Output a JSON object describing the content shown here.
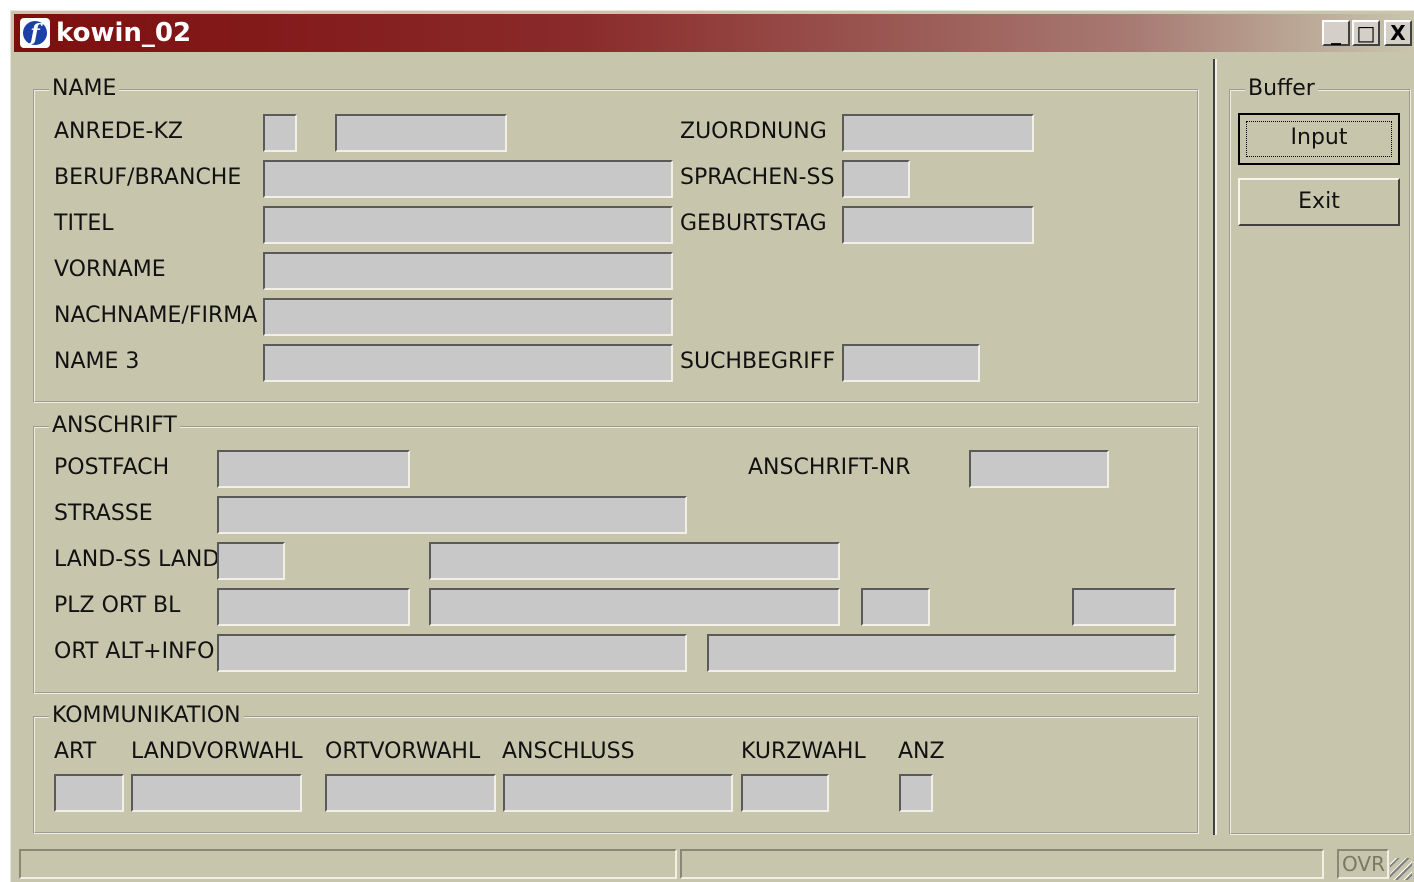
{
  "window": {
    "title": "kowin_02",
    "controls": {
      "minimize": "_",
      "maximize": "□",
      "close": "X"
    }
  },
  "name_group": {
    "legend": "NAME",
    "anrede_label": "ANREDE-KZ",
    "zuordnung_label": "ZUORDNUNG",
    "beruf_label": "BERUF/BRANCHE",
    "sprachen_label": "SPRACHEN-SS",
    "titel_label": "TITEL",
    "geburtstag_label": "GEBURTSTAG",
    "vorname_label": "VORNAME",
    "nachname_label": "NACHNAME/FIRMA",
    "name3_label": "NAME 3",
    "suchbegriff_label": "SUCHBEGRIFF"
  },
  "anschrift_group": {
    "legend": "ANSCHRIFT",
    "postfach_label": "POSTFACH",
    "anschrift_nr_label": "ANSCHRIFT-NR",
    "strasse_label": "STRASSE",
    "land_label": "LAND-SS LAND",
    "plz_label": "PLZ ORT BL",
    "ort_alt_label": "ORT ALT+INFO"
  },
  "kommunikation_group": {
    "legend": "KOMMUNIKATION",
    "columns": [
      "ART",
      "LANDVORWAHL",
      "ORTVORWAHL",
      "ANSCHLUSS",
      "KURZWAHL",
      "ANZ"
    ]
  },
  "buffer_group": {
    "legend": "Buffer",
    "input_button": "Input",
    "exit_button": "Exit"
  },
  "statusbar": {
    "mode": "OVR"
  }
}
